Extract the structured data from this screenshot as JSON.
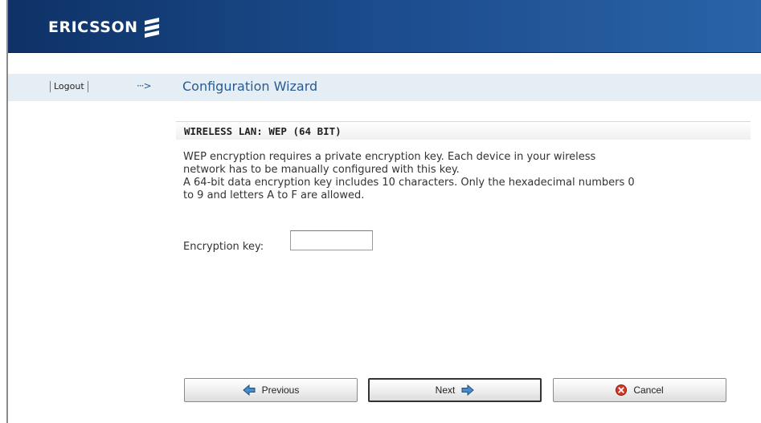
{
  "header": {
    "brand": "ERICSSON"
  },
  "nav": {
    "logout_label": "Logout",
    "arrow": "···>",
    "title": "Configuration Wizard"
  },
  "section": {
    "title": "WIRELESS LAN: WEP (64 BIT)",
    "lines": [
      "WEP encryption requires a private encryption key. Each device in your wireless",
      "network has to be manually configured with this key.",
      "A 64-bit data encryption key includes 10 characters. Only the hexadecimal numbers 0",
      "to 9 and letters A to F are allowed."
    ]
  },
  "form": {
    "key_label": "Encryption key:",
    "key_value": ""
  },
  "buttons": {
    "previous": "Previous",
    "next": "Next",
    "cancel": "Cancel"
  },
  "icons": {
    "previous": "arrow-left-icon",
    "next": "arrow-right-icon",
    "cancel": "cancel-icon",
    "brand": "ericsson-logo-icon"
  },
  "colors": {
    "header": "#1a4a8a",
    "navbar": "#e6eef5",
    "title": "#2a5a90",
    "arrow_icon": "#4a8cc8",
    "cancel_icon": "#d43a2a"
  }
}
